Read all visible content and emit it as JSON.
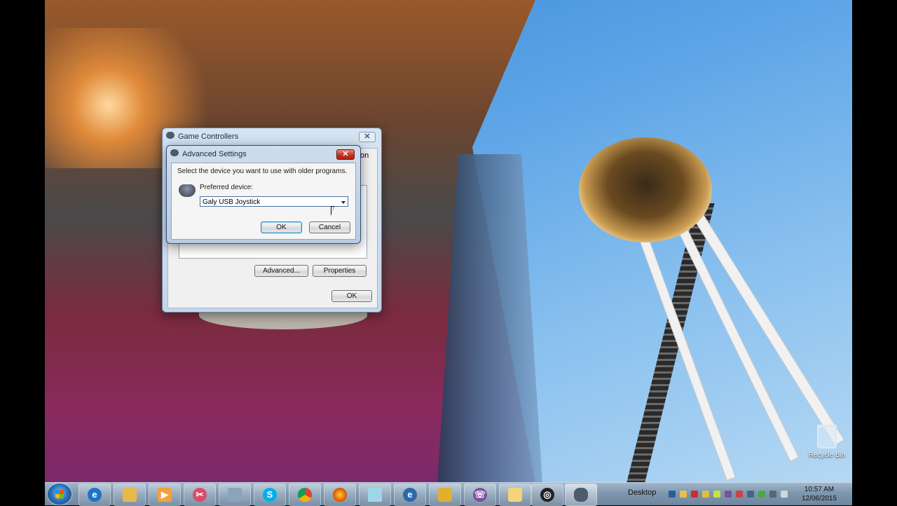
{
  "game_controllers": {
    "title": "Game Controllers",
    "peek_text": "on",
    "advanced_button": "Advanced...",
    "properties_button": "Properties",
    "ok_button": "OK"
  },
  "advanced_settings": {
    "title": "Advanced Settings",
    "instruction": "Select the device you want to use with older programs.",
    "preferred_label": "Preferred device:",
    "preferred_value": "Galy USB Joystick",
    "ok_button": "OK",
    "cancel_button": "Cancel"
  },
  "desktop": {
    "recycle_bin_label": "Recycle Bin"
  },
  "taskbar": {
    "desktop_label": "Desktop",
    "time": "10:57 AM",
    "date": "12/06/2015",
    "pinned_icons": [
      "internet-explorer-icon",
      "file-explorer-icon",
      "media-player-icon",
      "snipping-tool-icon",
      "calculator-icon",
      "skype-icon",
      "chrome-icon",
      "firefox-icon",
      "notepad-icon",
      "network-globe-icon",
      "lock-app-icon",
      "viber-icon",
      "folder-app-icon",
      "obs-icon",
      "game-controllers-icon"
    ]
  },
  "colors": {
    "taskbar": "#7f97ae",
    "close_red": "#c83020",
    "default_button_border": "#3c7fb1"
  }
}
